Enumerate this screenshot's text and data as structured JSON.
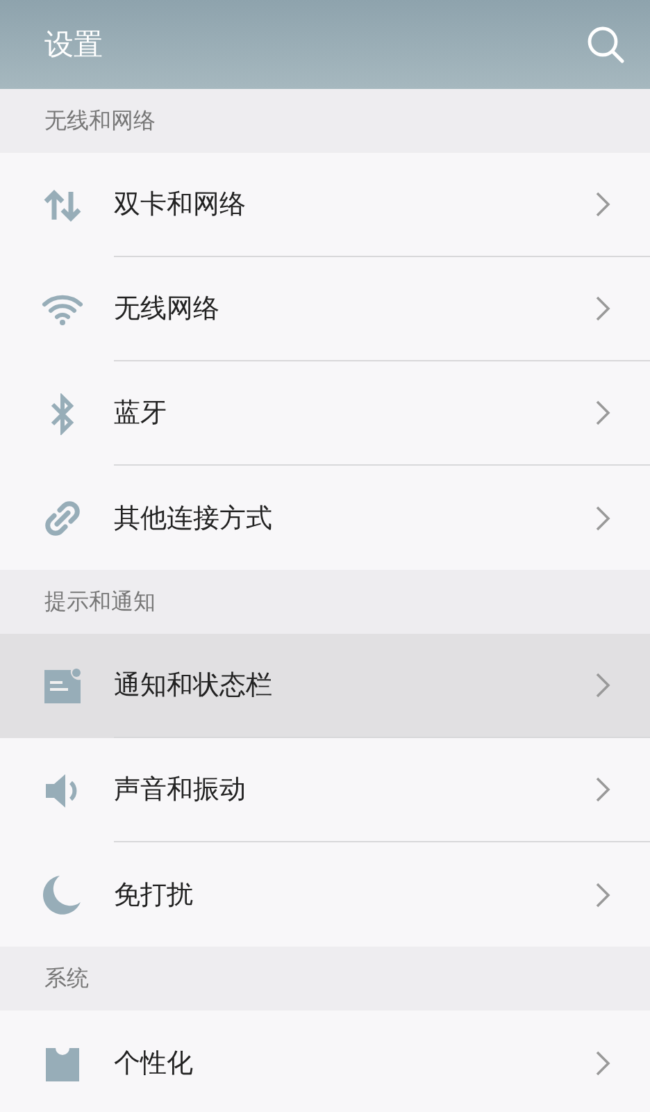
{
  "header": {
    "title": "设置"
  },
  "sections": [
    {
      "title": "无线和网络",
      "items": [
        {
          "label": "双卡和网络",
          "kind": "data",
          "highlighted": false
        },
        {
          "label": "无线网络",
          "kind": "wifi",
          "highlighted": false
        },
        {
          "label": "蓝牙",
          "kind": "bluetooth",
          "highlighted": false
        },
        {
          "label": "其他连接方式",
          "kind": "link",
          "highlighted": false
        }
      ]
    },
    {
      "title": "提示和通知",
      "items": [
        {
          "label": "通知和状态栏",
          "kind": "notification",
          "highlighted": true
        },
        {
          "label": "声音和振动",
          "kind": "sound",
          "highlighted": false
        },
        {
          "label": "免打扰",
          "kind": "moon",
          "highlighted": false
        }
      ]
    },
    {
      "title": "系统",
      "items": [
        {
          "label": "个性化",
          "kind": "shirt",
          "highlighted": false
        }
      ]
    }
  ]
}
